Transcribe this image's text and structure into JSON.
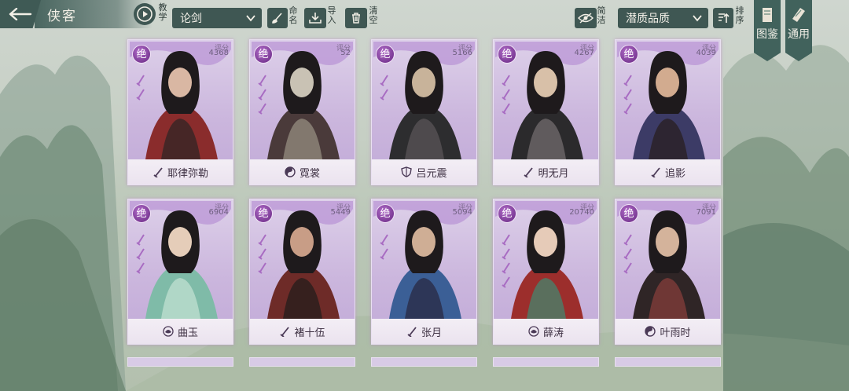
{
  "header": {
    "title": "侠客",
    "tutorial_label": "教学",
    "filter_select": "论剑",
    "rename_label": "命名",
    "import_label": "导入",
    "clear_label": "清空",
    "simple_label": "简洁",
    "quality_select": "潜质品质",
    "sort_label": "排序"
  },
  "side_tabs": [
    {
      "label": "图鉴"
    },
    {
      "label": "通用"
    }
  ],
  "card_common": {
    "rarity": "绝",
    "score_label": "评分"
  },
  "cards": [
    {
      "name": "耶律弥勒",
      "score": "4368",
      "sect_icon": "sword-icon",
      "skills": 2
    },
    {
      "name": "霓裳",
      "score": "52",
      "sect_icon": "taiji-icon",
      "skills": 3
    },
    {
      "name": "吕元震",
      "score": "5166",
      "sect_icon": "shield-icon",
      "skills": 2
    },
    {
      "name": "明无月",
      "score": "4267",
      "sect_icon": "sword-icon",
      "skills": 3
    },
    {
      "name": "追影",
      "score": "4039",
      "sect_icon": "sword-icon",
      "skills": 3
    },
    {
      "name": "曲玉",
      "score": "6904",
      "sect_icon": "lotus-icon",
      "skills": 3
    },
    {
      "name": "褚十伍",
      "score": "5449",
      "sect_icon": "sword-icon",
      "skills": 3
    },
    {
      "name": "张月",
      "score": "5094",
      "sect_icon": "sword-icon",
      "skills": 2
    },
    {
      "name": "薛涛",
      "score": "20740",
      "sect_icon": "lotus-icon",
      "skills": 4
    },
    {
      "name": "叶雨时",
      "score": "7091",
      "sect_icon": "taiji-icon",
      "skills": 3
    }
  ]
}
